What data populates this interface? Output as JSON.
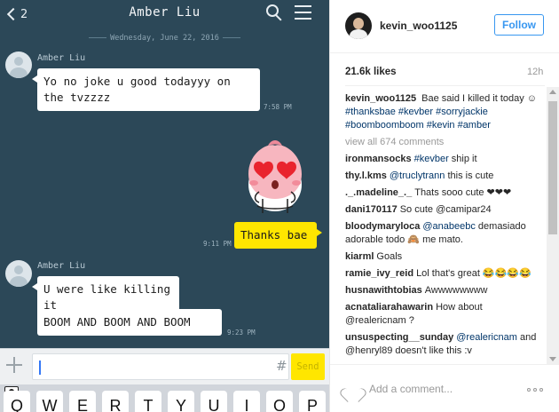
{
  "chat": {
    "header": {
      "back_count": "2",
      "title": "Amber Liu"
    },
    "date_separator": "Wednesday, June 22, 2016",
    "messages": [
      {
        "sender": "Amber Liu",
        "bubbles": [
          "Yo no joke u good todayyy on the tvzzzz"
        ],
        "time": "7:58 PM"
      },
      {
        "sticker": "peach-heart-eyes-sticker"
      },
      {
        "from_me": true,
        "text": "Thanks bae",
        "time": "9:11 PM"
      },
      {
        "sender": "Amber Liu",
        "bubbles": [
          "U were like killing it",
          "BOOM AND BOOM AND BOOM"
        ],
        "time": "9:23 PM"
      }
    ],
    "input": {
      "value": "",
      "hash_label": "#",
      "send_label": "Send"
    },
    "keyboard": {
      "keys": [
        "Q",
        "W",
        "E",
        "R",
        "T",
        "Y",
        "U",
        "I",
        "O",
        "P"
      ]
    },
    "colors": {
      "background": "#2c4858",
      "my_bubble": "#ffe600",
      "bubble": "#ffffff"
    }
  },
  "instagram": {
    "username": "kevin_woo1125",
    "follow_label": "Follow",
    "likes": "21.6k likes",
    "age": "12h",
    "caption": {
      "user": "kevin_woo1125",
      "text": "Bae said I killed it today ☺",
      "tags": "#thanksbae #kevber #sorryjackie #boomboomboom #kevin #amber"
    },
    "view_all": "view all 674 comments",
    "comments": [
      {
        "user": "ironmansocks",
        "link": "#kevber",
        "text": " ship it"
      },
      {
        "user": "thy.l.kms",
        "link": "@truclytrann",
        "text": " this is cute"
      },
      {
        "user": "._.madeline_._",
        "link": "",
        "text": "Thats sooo cute ❤❤❤"
      },
      {
        "user": "dani170117",
        "link": "",
        "text": "So cute @camipar24"
      },
      {
        "user": "bloodymaryloca",
        "link": "@anabeebc",
        "text": " demasiado adorable todo 🙈 me mato."
      },
      {
        "user": "kiarml",
        "link": "",
        "text": "Goals"
      },
      {
        "user": "ramie_ivy_reid",
        "link": "",
        "text": "Lol that's great 😂😂😂😂"
      },
      {
        "user": "husnawithtobias",
        "link": "",
        "text": "Awwwwwwww"
      },
      {
        "user": "acnataliarahawarin",
        "link": "",
        "text": "How about @realericnam ?"
      },
      {
        "user": "unsuspecting__sunday",
        "link": "@realericnam",
        "text": " and @henryl89 doesn't like this :v"
      }
    ],
    "add_comment_placeholder": "Add a comment...",
    "colors": {
      "link": "#003569",
      "follow": "#3897f0"
    }
  }
}
